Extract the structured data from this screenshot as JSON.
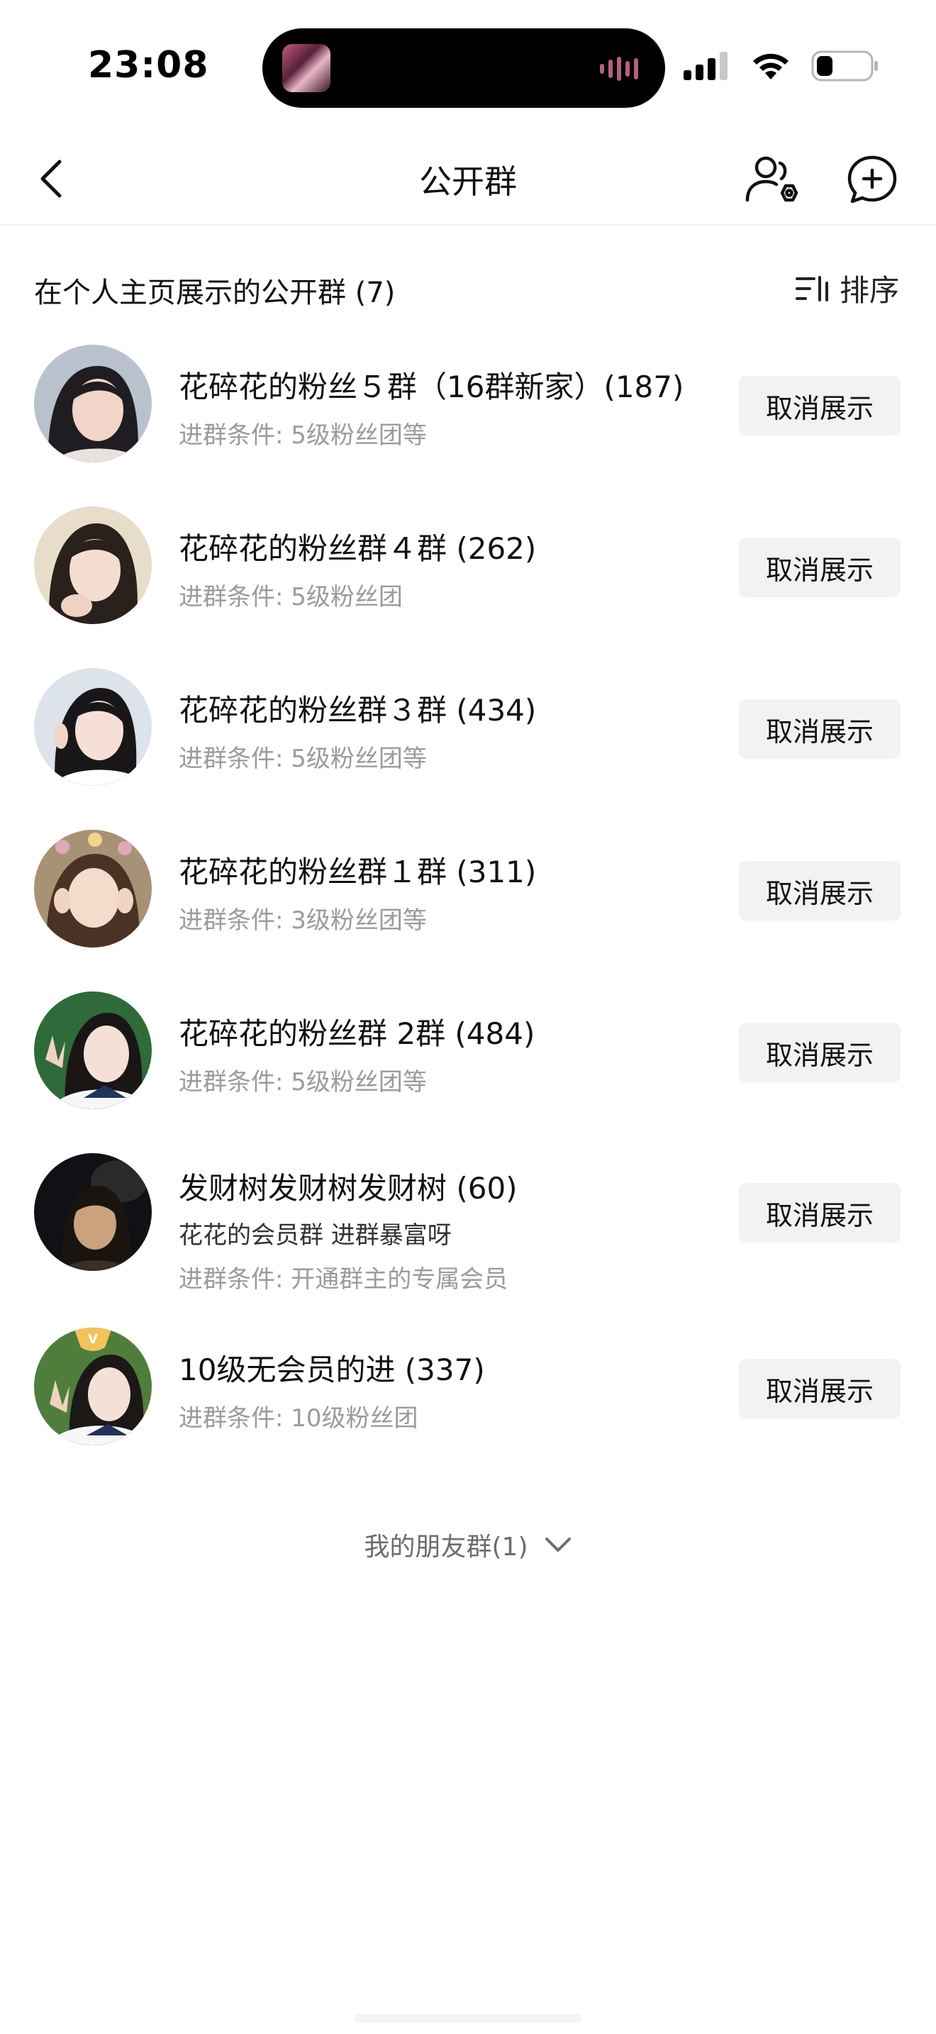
{
  "status_bar": {
    "time": "23:08",
    "icons": [
      "signal-icon",
      "wifi-icon",
      "battery-icon"
    ]
  },
  "nav": {
    "title": "公开群",
    "back_icon": "chevron-left-icon",
    "manage_icon": "group-settings-icon",
    "add_icon": "add-chat-icon"
  },
  "section": {
    "title": "在个人主页展示的公开群 (7)",
    "sort_label": "排序",
    "sort_icon": "sort-icon"
  },
  "groups": [
    {
      "name": "花碎花的粉丝５群（16群新家）(187)",
      "desc": "",
      "condition": "进群条件: 5级粉丝团等",
      "button": "取消展示"
    },
    {
      "name": "花碎花的粉丝群４群 (262)",
      "desc": "",
      "condition": "进群条件: 5级粉丝团",
      "button": "取消展示"
    },
    {
      "name": "花碎花的粉丝群３群 (434)",
      "desc": "",
      "condition": "进群条件: 5级粉丝团等",
      "button": "取消展示"
    },
    {
      "name": "花碎花的粉丝群１群 (311)",
      "desc": "",
      "condition": "进群条件: 3级粉丝团等",
      "button": "取消展示"
    },
    {
      "name": "花碎花的粉丝群 2群 (484)",
      "desc": "",
      "condition": "进群条件: 5级粉丝团等",
      "button": "取消展示"
    },
    {
      "name": "发财树发财树发财树 (60)",
      "desc": "花花的会员群 进群暴富呀",
      "condition": "进群条件: 开通群主的专属会员",
      "button": "取消展示"
    },
    {
      "name": "10级无会员的进 (337)",
      "desc": "",
      "condition": "进群条件: 10级粉丝团",
      "button": "取消展示"
    }
  ],
  "friends_toggle": {
    "label": "我的朋友群(1)",
    "icon": "chevron-down-icon"
  },
  "colors": {
    "button_bg": "#f2f2f2",
    "muted_text": "#9b9b9b",
    "primary_text": "#111111"
  }
}
